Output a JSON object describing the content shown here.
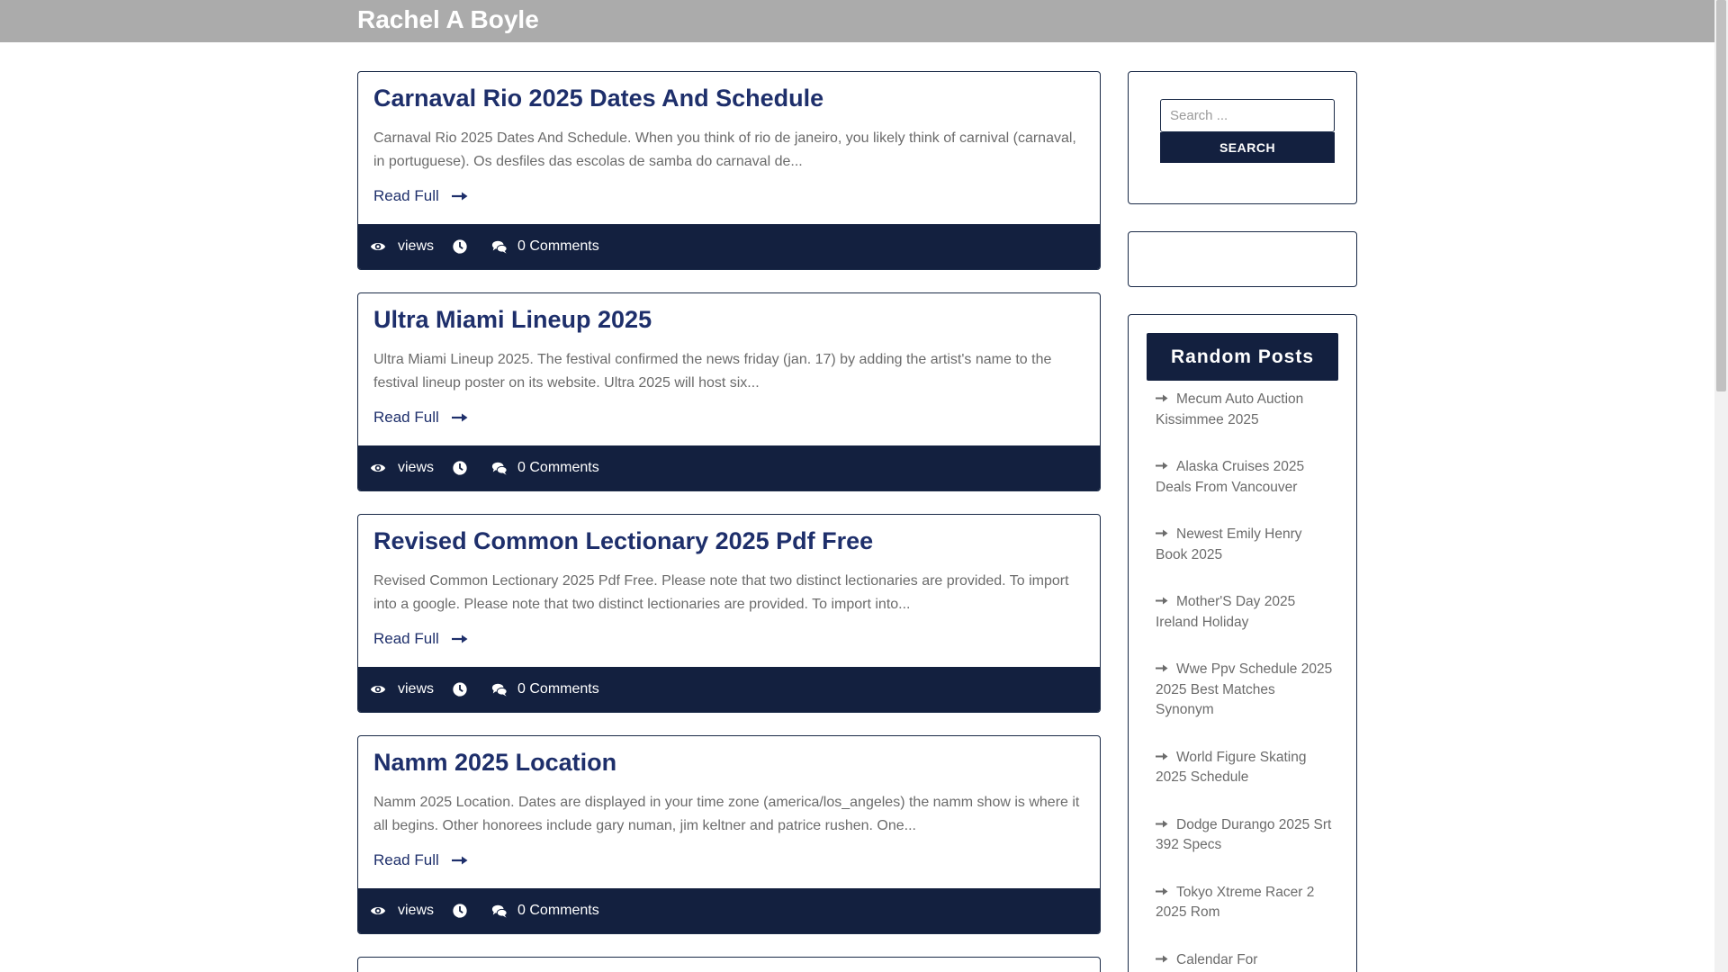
{
  "header": {
    "site_title": "Rachel A Boyle"
  },
  "posts": [
    {
      "title": "Carnaval Rio 2025 Dates And Schedule",
      "excerpt": "Carnaval Rio 2025 Dates And Schedule. When you think of rio de janeiro, you likely think of carnival (carnaval, in portuguese). Os desfiles das escolas de samba do carnaval de...",
      "read_label": "Read Full",
      "views_label": "views",
      "comments_label": "0 Comments"
    },
    {
      "title": "Ultra Miami Lineup 2025",
      "excerpt": "Ultra Miami Lineup 2025. The festival confirmed the news friday (jan. 17) by adding the artist's name to the festival lineup poster on its website. Ultra 2025 will host six...",
      "read_label": "Read Full",
      "views_label": "views",
      "comments_label": "0 Comments"
    },
    {
      "title": "Revised Common Lectionary 2025 Pdf Free",
      "excerpt": "Revised Common Lectionary 2025 Pdf Free. Please note that two distinct lectionaries are provided. To import into a google. Please note that two distinct lectionaries are provided. To import into...",
      "read_label": "Read Full",
      "views_label": "views",
      "comments_label": "0 Comments"
    },
    {
      "title": "Namm 2025 Location",
      "excerpt": "Namm 2025 Location. Dates are displayed in your time zone (america/los_angeles) the namm show is where it all begins. Other honorees include gary numan, jim keltner and patrice rushen. One...",
      "read_label": "Read Full",
      "views_label": "views",
      "comments_label": "0 Comments"
    }
  ],
  "sidebar": {
    "search": {
      "placeholder": "Search ...",
      "value": "",
      "button_label": "SEARCH"
    },
    "random_posts": {
      "title": "Random Posts",
      "items": [
        "Mecum Auto Auction Kissimmee 2025",
        "Alaska Cruises 2025 Deals From Vancouver",
        "Newest Emily Henry Book 2025",
        "Mother'S Day 2025 Ireland Holiday",
        "Wwe Ppv Schedule 2025 2025 Best Matches Synonym",
        "World Figure Skating 2025 Schedule",
        "Dodge Durango 2025 Srt 392 Specs",
        "Tokyo Xtreme Racer 2 2025 Rom",
        "Calendar For"
      ]
    }
  },
  "icons": {
    "views": "eye-icon",
    "time": "clock-icon",
    "comments": "comments-icon",
    "read_more": "arrow-right-icon"
  },
  "colors": {
    "primary": "#13203f",
    "title": "#1e2f6b",
    "header_bg": "#ababab",
    "text_muted": "#6b6b6b"
  }
}
